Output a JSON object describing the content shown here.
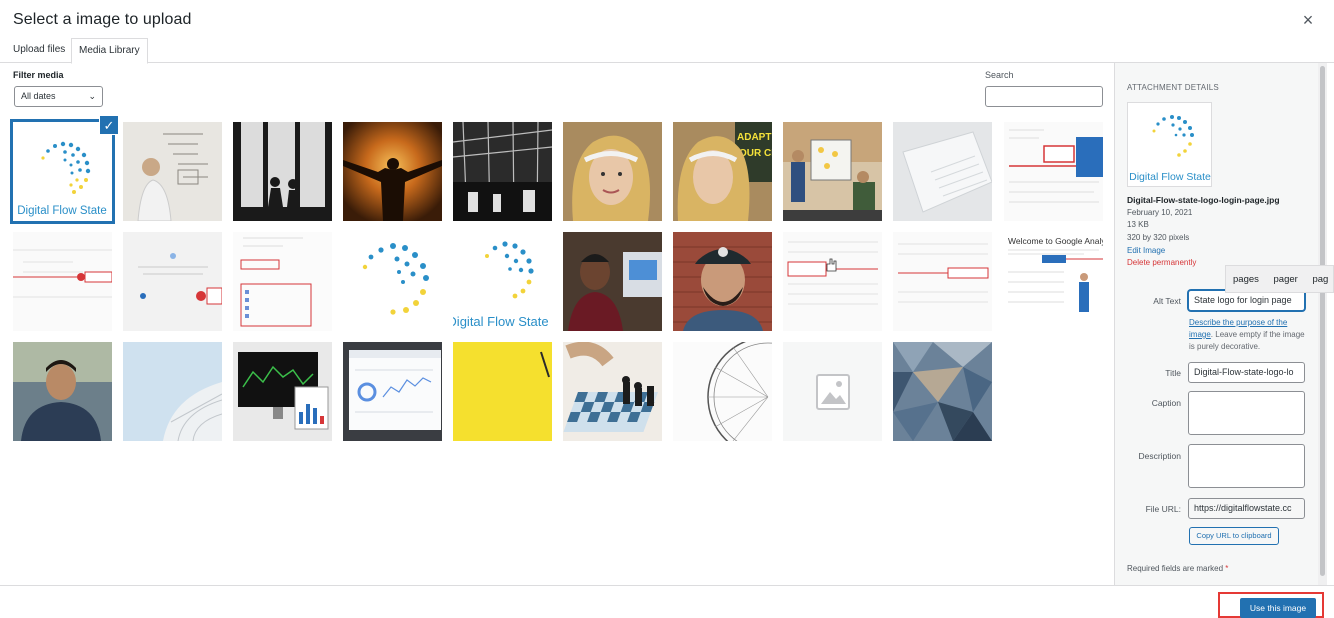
{
  "modal": {
    "title": "Select a image to upload",
    "close_symbol": "×"
  },
  "tabs": [
    {
      "label": "Upload files"
    },
    {
      "label": "Media Library",
      "active": true
    }
  ],
  "filter": {
    "label": "Filter media",
    "date_value": "All dates",
    "chevron": "⌄"
  },
  "search": {
    "label": "Search",
    "value": ""
  },
  "grid": {
    "selected_check": "✓",
    "logo_caption": "Digital Flow State",
    "logo_caption_partial": "Digital Flow State",
    "thumbs": [
      "digital-flow-state-logo-selected",
      "whiteboard-man",
      "window-silhouettes",
      "sunset-arms",
      "dark-building",
      "woman-headband",
      "woman-headband-adapting",
      "presentation-group",
      "laptop-white",
      "screenshot-ui",
      "screenshot-ga-1",
      "screenshot-ga-setup",
      "screenshot-list",
      "digital-flow-swirl",
      "digital-flow-state-logo",
      "man-smiling",
      "man-cap-beard",
      "screenshot-property",
      "screenshot-form",
      "welcome-google-analytics",
      "man-portrait",
      "white-dome",
      "trading-screens",
      "dashboard-laptop",
      "yellow-paper",
      "chess-board",
      "ferris-wheel",
      "placeholder",
      "polygon-pattern"
    ]
  },
  "attachment_details": {
    "heading": "ATTACHMENT DETAILS",
    "logo_caption": "Digital Flow State",
    "filename": "Digital-Flow-state-logo-login-page.jpg",
    "date": "February 10, 2021",
    "size": "13 KB",
    "dimensions": "320 by 320 pixels",
    "edit_link": "Edit Image",
    "delete_link": "Delete permanently"
  },
  "autocomplete_tooltip": "pages pager pag",
  "fields": {
    "alt_text_label": "Alt Text",
    "alt_text_value": "State logo for login page",
    "alt_help_link": "Describe the purpose of the image",
    "alt_help_rest": ". Leave empty if the image is purely decorative.",
    "title_label": "Title",
    "title_value": "Digital-Flow-state-logo-lo",
    "caption_label": "Caption",
    "caption_value": "",
    "description_label": "Description",
    "description_value": "",
    "file_url_label": "File URL:",
    "file_url_value": "https://digitalflowstate.cc",
    "copy_button": "Copy URL to clipboard"
  },
  "required_note": "Required fields are marked",
  "required_star": "*",
  "footer": {
    "use_button": "Use this image"
  },
  "colors": {
    "accent": "#2271b1",
    "danger": "#d63638",
    "highlight_border": "#e53935"
  }
}
